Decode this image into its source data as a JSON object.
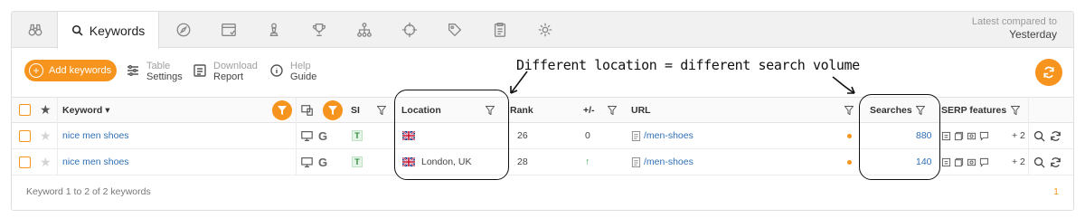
{
  "tabs": [
    {
      "name": "binoculars-icon"
    },
    {
      "name": "search-icon",
      "label": "Keywords",
      "active": true
    },
    {
      "name": "compass-icon"
    },
    {
      "name": "browser-window-icon"
    },
    {
      "name": "chess-pawn-icon"
    },
    {
      "name": "trophy-icon"
    },
    {
      "name": "site-structure-icon"
    },
    {
      "name": "crosshair-icon"
    },
    {
      "name": "tag-icon"
    },
    {
      "name": "clipboard-icon"
    },
    {
      "name": "gear-puzzle-icon"
    }
  ],
  "compare": {
    "label": "Latest compared to",
    "value": "Yesterday"
  },
  "toolbar": {
    "add_label": "Add keywords",
    "table_settings": {
      "line1": "Table",
      "line2": "Settings"
    },
    "download_report": {
      "line1": "Download",
      "line2": "Report"
    },
    "help_guide": {
      "line1": "Help",
      "line2": "Guide"
    }
  },
  "annotation": "Different location = different search volume",
  "columns": {
    "keyword": "Keyword ▾",
    "si": "SI",
    "location": "Location",
    "rank": "Rank",
    "change": "+/-",
    "url": "URL",
    "searches": "Searches",
    "serp": "SERP features"
  },
  "rows": [
    {
      "keyword": "nice men shoes",
      "si": "T",
      "location": "",
      "rank": "26",
      "change": "0",
      "url": "/men-shoes",
      "searches": "880",
      "serp_more": "+ 2"
    },
    {
      "keyword": "nice men shoes",
      "si": "T",
      "location": "London, UK",
      "rank": "28",
      "change": "↑",
      "url": "/men-shoes",
      "searches": "140",
      "serp_more": "+ 2"
    }
  ],
  "footer": {
    "summary": "Keyword 1 to 2 of 2 keywords",
    "page": "1"
  },
  "colors": {
    "accent": "#f7941d",
    "link": "#2f6fb5",
    "up": "#3aa655"
  }
}
